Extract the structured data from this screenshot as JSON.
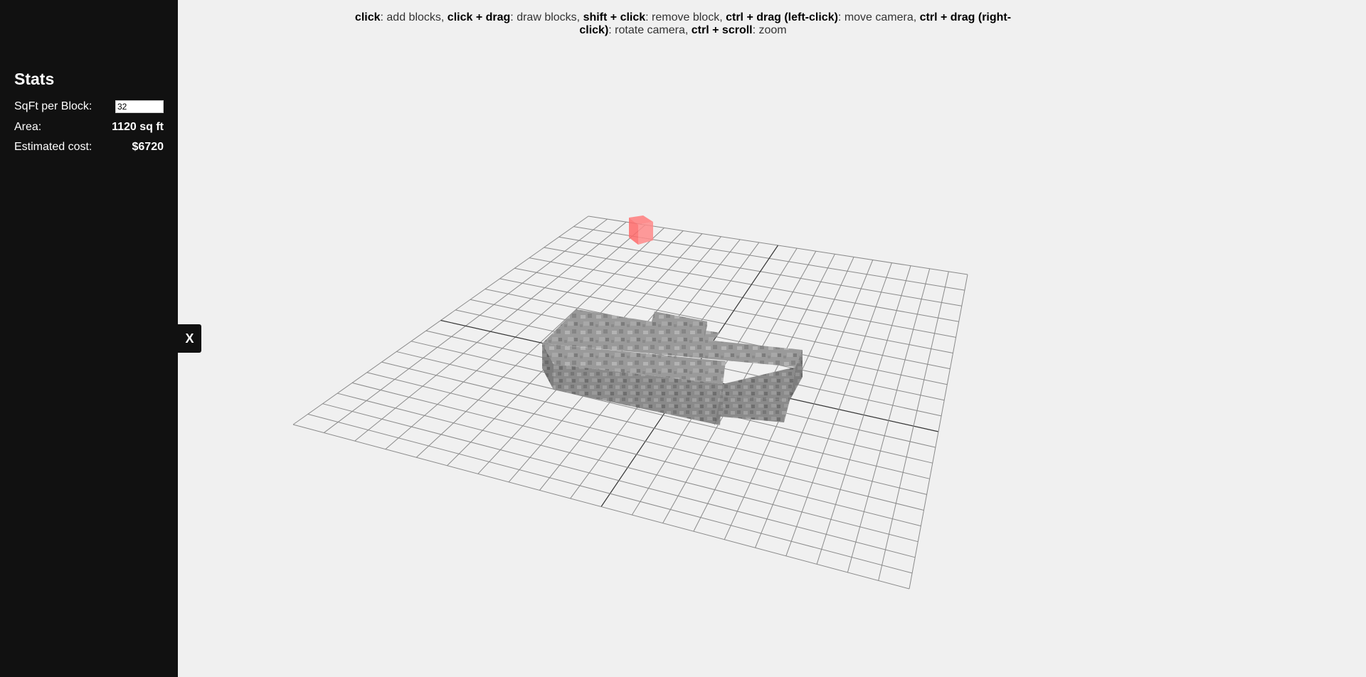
{
  "sidebar": {
    "title": "Stats",
    "sqft_label": "SqFt per Block:",
    "sqft_value": "32",
    "area_label": "Area:",
    "area_value": "1120 sq ft",
    "cost_label": "Estimated cost:",
    "cost_value": "$6720",
    "toggle_label": "X"
  },
  "instructions": [
    {
      "key": "click",
      "desc": ": add blocks, "
    },
    {
      "key": "click + drag",
      "desc": ": draw blocks, "
    },
    {
      "key": "shift + click",
      "desc": ": remove block, "
    },
    {
      "key": "ctrl + drag (left-click)",
      "desc": ": move camera, "
    },
    {
      "key": "ctrl + drag (right-click)",
      "desc": ": rotate camera, "
    },
    {
      "key": "ctrl + scroll",
      "desc": ": zoom"
    }
  ],
  "scene": {
    "grid_size": 20,
    "block_color": "#8c8c8c",
    "cursor_color": "#ff5a5a",
    "grid_color": "#8a8a8a"
  }
}
